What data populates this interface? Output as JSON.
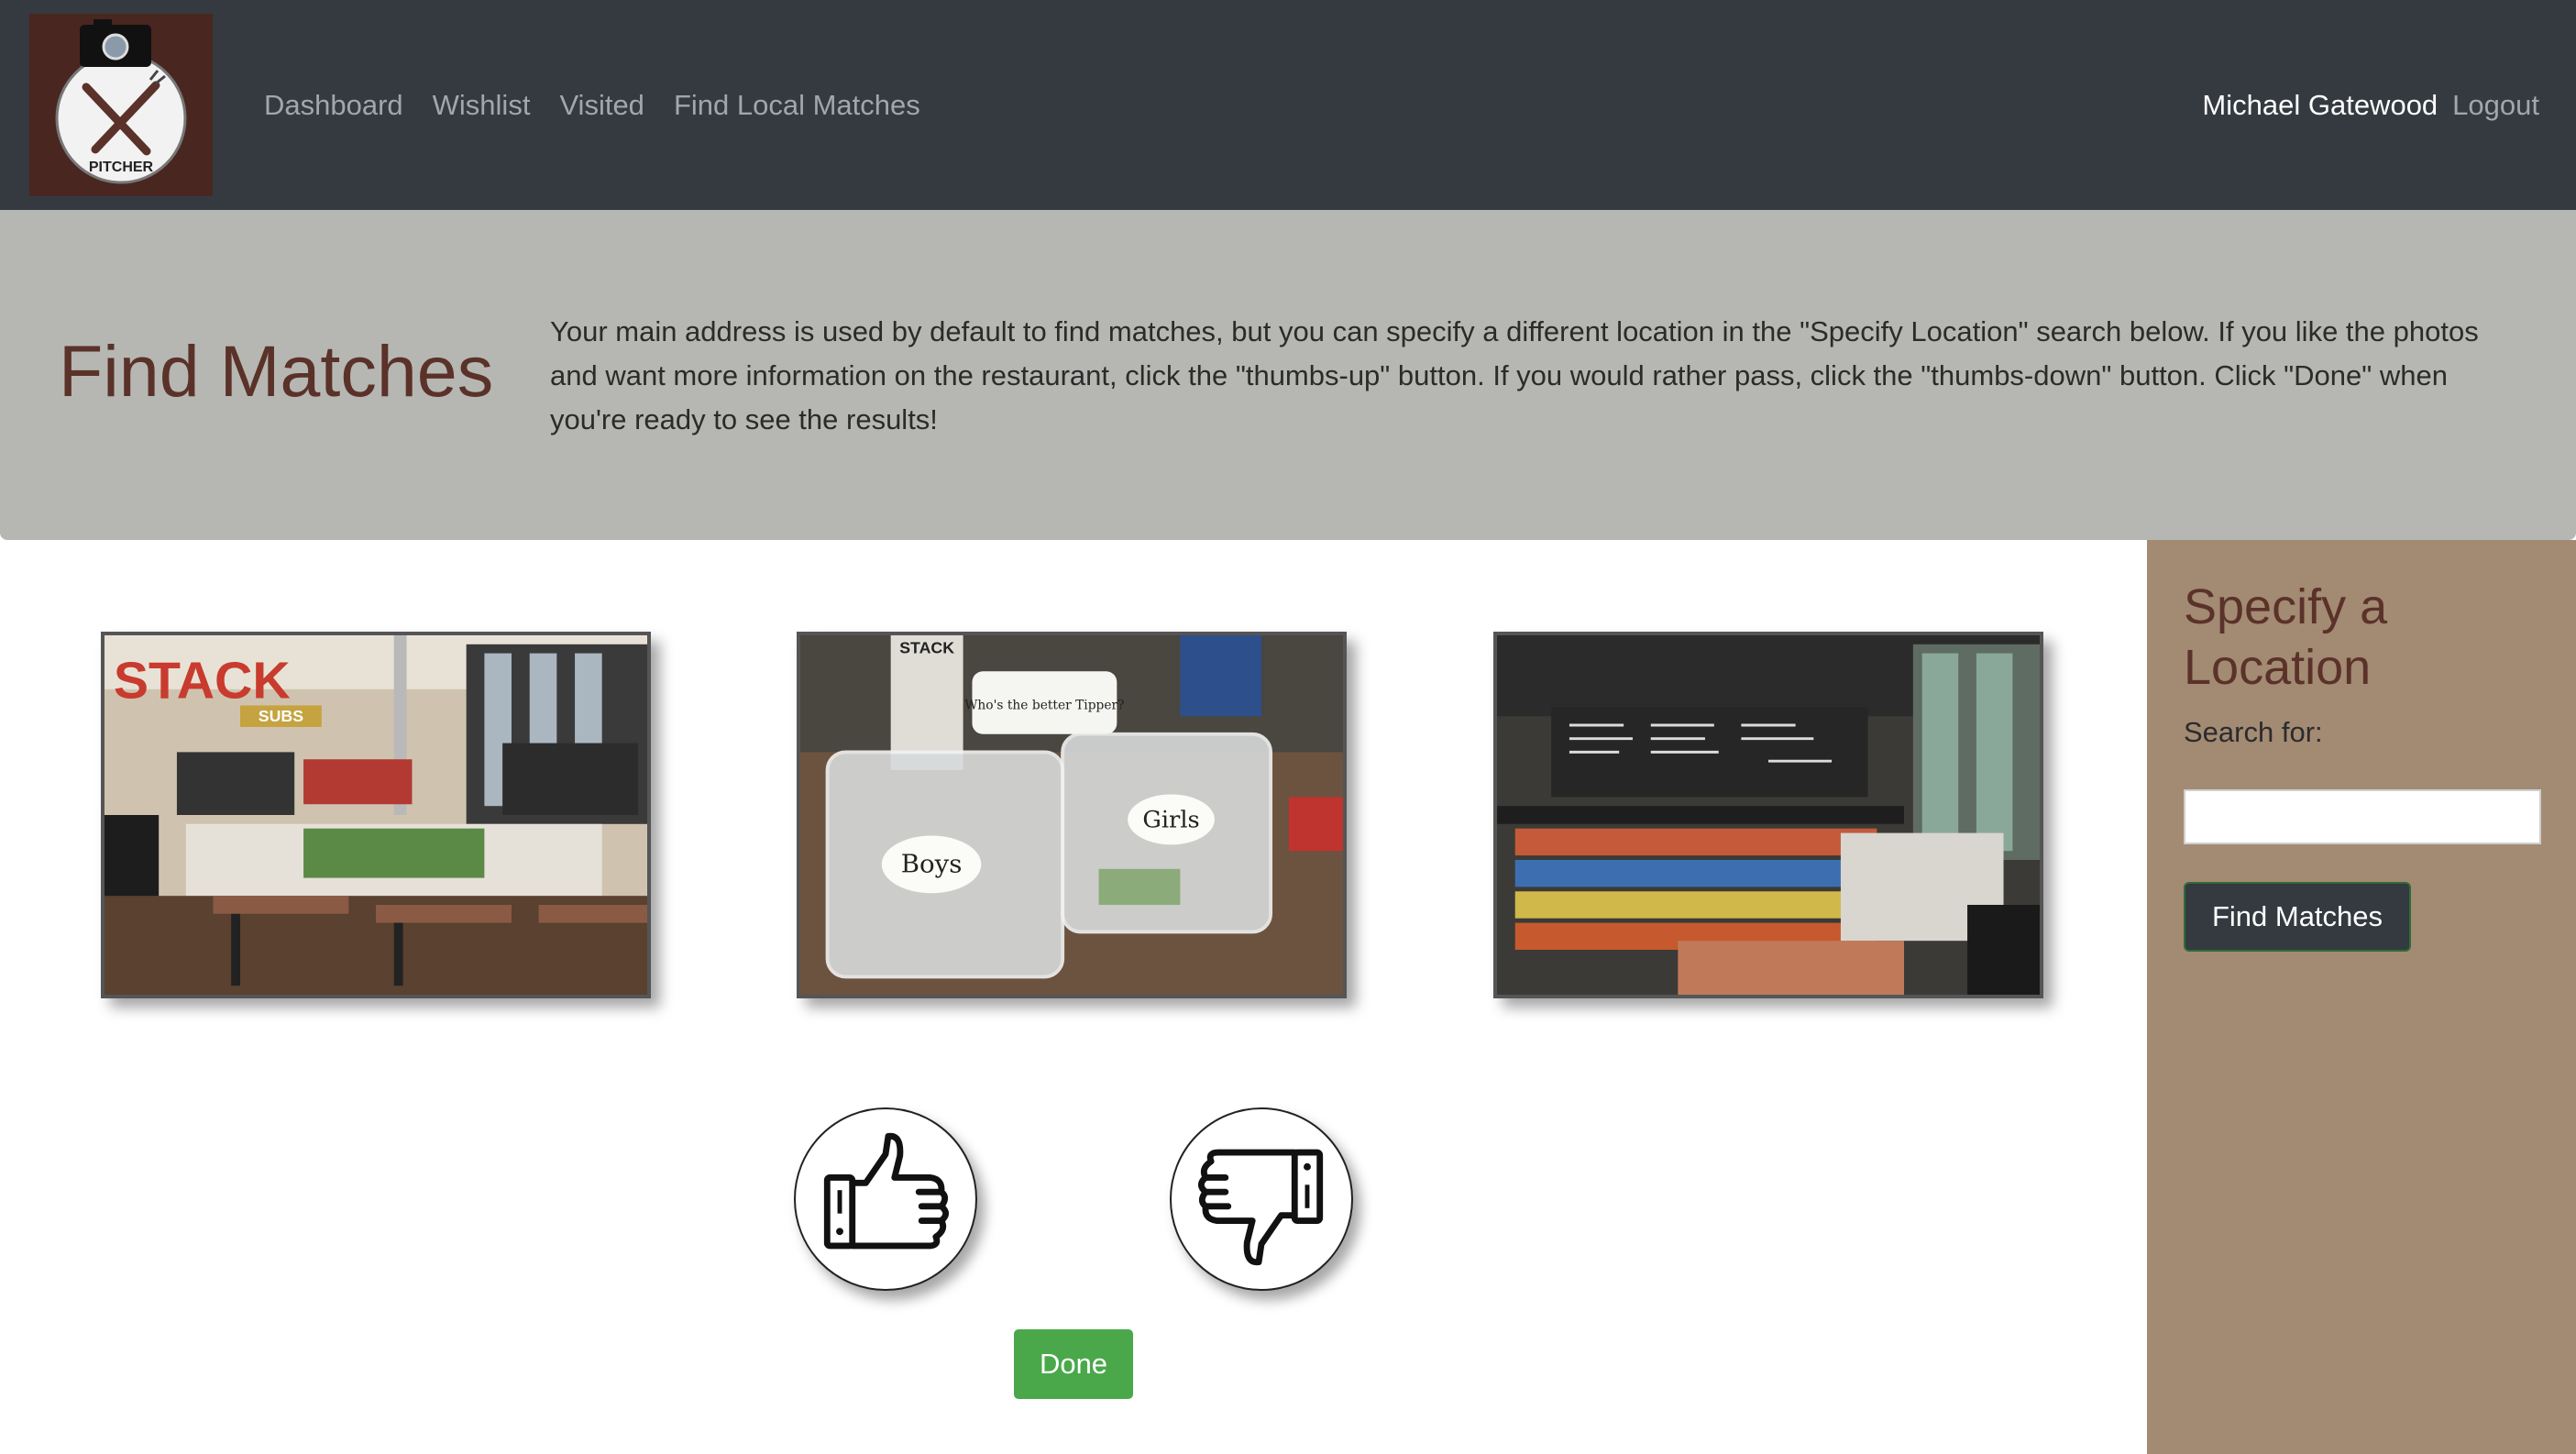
{
  "navbar": {
    "logo_text": "PITCHER",
    "links": [
      "Dashboard",
      "Wishlist",
      "Visited",
      "Find Local Matches"
    ],
    "user_name": "Michael Gatewood",
    "logout": "Logout"
  },
  "jumbotron": {
    "title": "Find Matches",
    "description": "Your main address is used by default to find matches, but you can specify a different location in the \"Specify Location\" search below. If you like the photos and want more information on the restaurant, click the \"thumbs-up\" button. If you would rather pass, click the \"thumbs-down\" button. Click \"Done\" when you're ready to see the results!"
  },
  "photos": [
    {
      "description": "Restaurant interior with STACK SUBS sign and dining tables"
    },
    {
      "description": "Tip jars labeled Boys and Girls with sign Who's the better Tipper?"
    },
    {
      "description": "Counter with chalkboard menu and snack racks"
    }
  ],
  "photo_text": {
    "sign": "STACK",
    "sign_sub": "SUBS",
    "tip_sign": "Who's the better Tipper?",
    "jar_left": "Boys",
    "jar_right": "Girls"
  },
  "actions": {
    "thumbs_up_icon": "thumbs-up-icon",
    "thumbs_down_icon": "thumbs-down-icon",
    "done_label": "Done"
  },
  "sidebar": {
    "title": "Specify a Location",
    "search_label": "Search for:",
    "search_value": "",
    "button_label": "Find Matches"
  },
  "colors": {
    "navbar": "#343a40",
    "jumbotron": "#b6b7b2",
    "heading": "#5a3229",
    "sidebar": "#a38a73",
    "done": "#4aa84a"
  }
}
